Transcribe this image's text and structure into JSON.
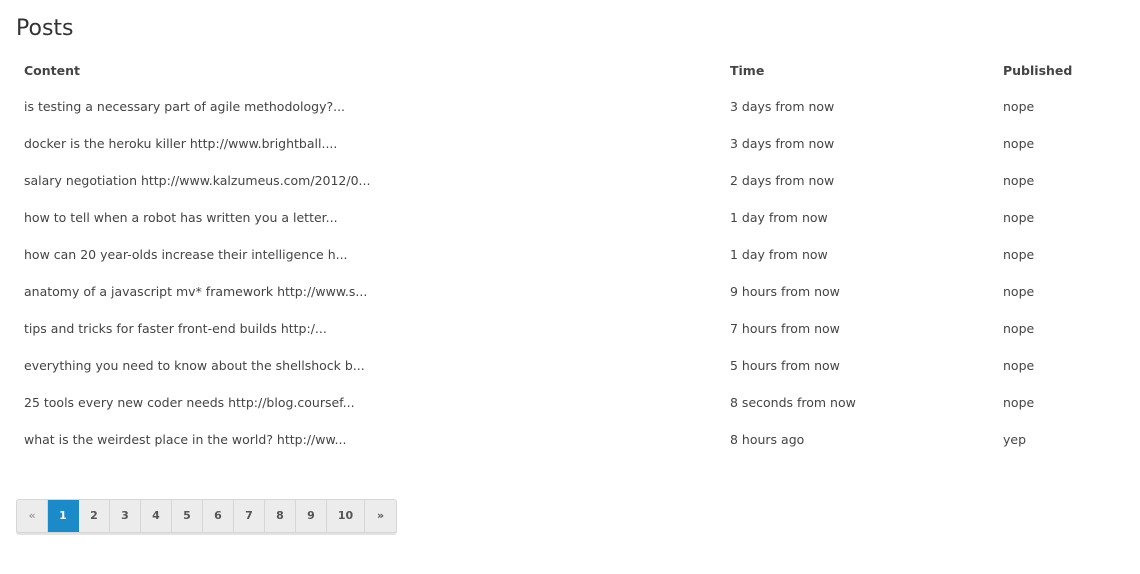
{
  "page": {
    "title": "Posts"
  },
  "table": {
    "headers": {
      "content": "Content",
      "time": "Time",
      "published": "Published"
    },
    "rows": [
      {
        "content": "is testing a necessary part of agile methodology?...",
        "time": "3 days from now",
        "published": "nope"
      },
      {
        "content": "docker is the heroku killer http://www.brightball....",
        "time": "3 days from now",
        "published": "nope"
      },
      {
        "content": "salary negotiation http://www.kalzumeus.com/2012/0...",
        "time": "2 days from now",
        "published": "nope"
      },
      {
        "content": "how to tell when a robot has written you a letter...",
        "time": "1 day from now",
        "published": "nope"
      },
      {
        "content": "how can 20 year-olds increase their intelligence h...",
        "time": "1 day from now",
        "published": "nope"
      },
      {
        "content": "anatomy of a javascript mv* framework http://www.s...",
        "time": "9 hours from now",
        "published": "nope"
      },
      {
        "content": "tips and tricks for faster front-end builds http:/...",
        "time": "7 hours from now",
        "published": "nope"
      },
      {
        "content": "everything you need to know about the shellshock b...",
        "time": "5 hours from now",
        "published": "nope"
      },
      {
        "content": "25 tools every new coder needs http://blog.coursef...",
        "time": "8 seconds from now",
        "published": "nope"
      },
      {
        "content": "what is the weirdest place in the world? http://ww...",
        "time": "8 hours ago",
        "published": "yep"
      }
    ]
  },
  "pagination": {
    "prev_label": "«",
    "next_label": "»",
    "pages": [
      "1",
      "2",
      "3",
      "4",
      "5",
      "6",
      "7",
      "8",
      "9",
      "10"
    ],
    "current": "1",
    "accent_color": "#1a8ac8"
  }
}
